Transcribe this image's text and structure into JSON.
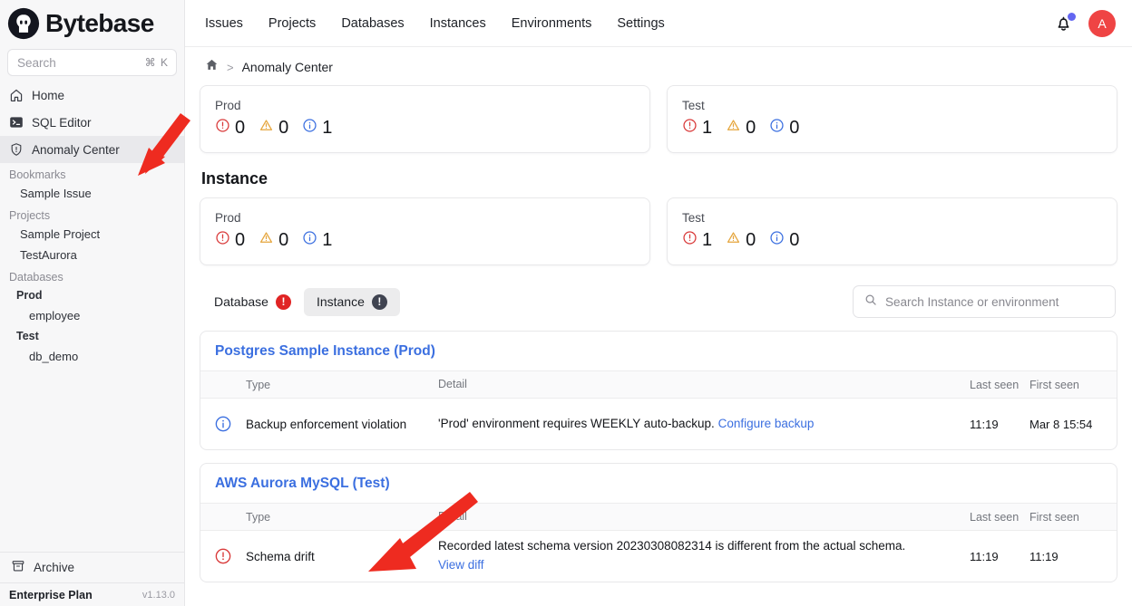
{
  "brand": {
    "name": "Bytebase",
    "logo_icon": "bytebase-logo-icon"
  },
  "sidebar": {
    "search": {
      "placeholder": "Search",
      "shortcut": "⌘ K",
      "icon": "search-icon"
    },
    "nav": [
      {
        "label": "Home",
        "icon": "home-icon",
        "active": false
      },
      {
        "label": "SQL Editor",
        "icon": "terminal-icon",
        "active": false
      },
      {
        "label": "Anomaly Center",
        "icon": "shield-alert-icon",
        "active": true
      }
    ],
    "groups": [
      {
        "label": "Bookmarks",
        "items": [
          {
            "label": "Sample Issue",
            "bold": false
          }
        ]
      },
      {
        "label": "Projects",
        "items": [
          {
            "label": "Sample Project",
            "bold": false
          },
          {
            "label": "TestAurora",
            "bold": false
          }
        ]
      },
      {
        "label": "Databases",
        "items": [
          {
            "label": "Prod",
            "bold": true
          },
          {
            "label": "employee",
            "bold": false,
            "deep": true
          },
          {
            "label": "Test",
            "bold": true
          },
          {
            "label": "db_demo",
            "bold": false,
            "deep": true
          }
        ]
      }
    ],
    "archive": {
      "label": "Archive",
      "icon": "archive-icon"
    },
    "plan": {
      "name": "Enterprise Plan",
      "version": "v1.13.0"
    }
  },
  "topbar": {
    "nav": [
      "Issues",
      "Projects",
      "Databases",
      "Instances",
      "Environments",
      "Settings"
    ],
    "bell_icon": "bell-icon",
    "notification_dot_color": "#6366f1",
    "avatar_initial": "A",
    "avatar_color": "#ef4444"
  },
  "breadcrumb": {
    "home_icon": "home-icon",
    "separator": ">",
    "current": "Anomaly Center"
  },
  "summary": {
    "environment_cards": [
      {
        "env": "Prod",
        "critical": "0",
        "warning": "0",
        "info": "1"
      },
      {
        "env": "Test",
        "critical": "1",
        "warning": "0",
        "info": "0"
      }
    ],
    "instance_section_title": "Instance",
    "instance_cards": [
      {
        "env": "Prod",
        "critical": "0",
        "warning": "0",
        "info": "1"
      },
      {
        "env": "Test",
        "critical": "1",
        "warning": "0",
        "info": "0"
      }
    ],
    "icons": {
      "critical": "error-circle-icon",
      "warning": "warning-triangle-icon",
      "info": "info-circle-icon"
    },
    "colors": {
      "critical": "#d93a3a",
      "warning": "#e5a53c",
      "info": "#3b6fe0"
    }
  },
  "tabs": [
    {
      "label": "Database",
      "count_badge": "!",
      "selected": false,
      "badge_color": "#e02424"
    },
    {
      "label": "Instance",
      "count_badge": "!",
      "selected": true,
      "badge_color": "#3f4350"
    }
  ],
  "search_filter": {
    "placeholder": "Search Instance or environment",
    "icon": "search-icon",
    "value": ""
  },
  "tables": [
    {
      "title": "Postgres Sample Instance (Prod)",
      "columns": {
        "type": "Type",
        "detail": "Detail",
        "last_seen": "Last seen",
        "first_seen": "First seen"
      },
      "rows": [
        {
          "severity": "info",
          "type": "Backup enforcement violation",
          "detail": "'Prod' environment requires WEEKLY auto-backup.",
          "detail_link": "Configure backup",
          "extra_link": "",
          "last_seen": "11:19",
          "first_seen": "Mar 8 15:54"
        }
      ]
    },
    {
      "title": "AWS Aurora MySQL (Test)",
      "columns": {
        "type": "Type",
        "detail": "Detail",
        "last_seen": "Last seen",
        "first_seen": "First seen"
      },
      "rows": [
        {
          "severity": "critical",
          "type": "Schema drift",
          "detail": "Recorded latest schema version 20230308082314 is different from the actual schema.",
          "detail_link": "",
          "extra_link": "View diff",
          "last_seen": "11:19",
          "first_seen": "11:19"
        }
      ]
    }
  ],
  "annotations": {
    "arrow_color": "#ee2b20",
    "arrows": [
      {
        "name": "arrow-to-anomaly-center"
      },
      {
        "name": "arrow-to-schema-drift-row"
      }
    ]
  }
}
